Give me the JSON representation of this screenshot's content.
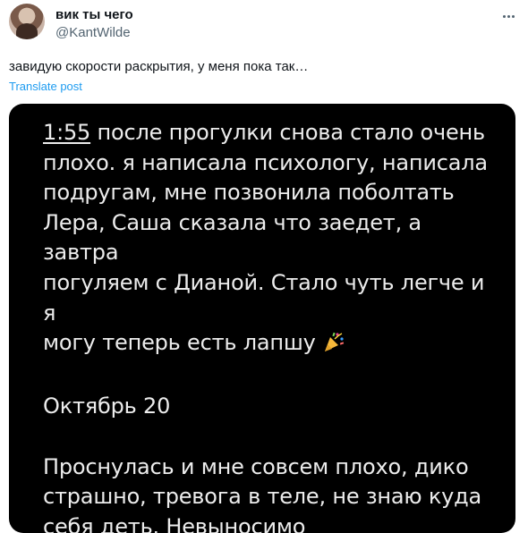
{
  "author": {
    "name": "вик ты чего",
    "handle": "@KantWilde"
  },
  "tweet": {
    "text": "завидую скорости раскрытия, у меня пока так…",
    "translate_label": "Translate post"
  },
  "media": {
    "time": "1:55",
    "entry1": " после прогулки снова стало очень\nплохо. я написала психологу, написала\nподругам, мне позвонила поболтать\nЛера, Саша сказала что заедет, а завтра\nпогуляем с Дианой. Стало чуть легче и я\nмогу теперь есть лапшу ",
    "date_heading": "Октябрь 20",
    "entry2": "Проснулась и мне совсем плохо, дико\nстрашно, тревога в теле, не знаю куда\nсебя деть. Невыносимо",
    "emoji": "party-popper-icon"
  }
}
